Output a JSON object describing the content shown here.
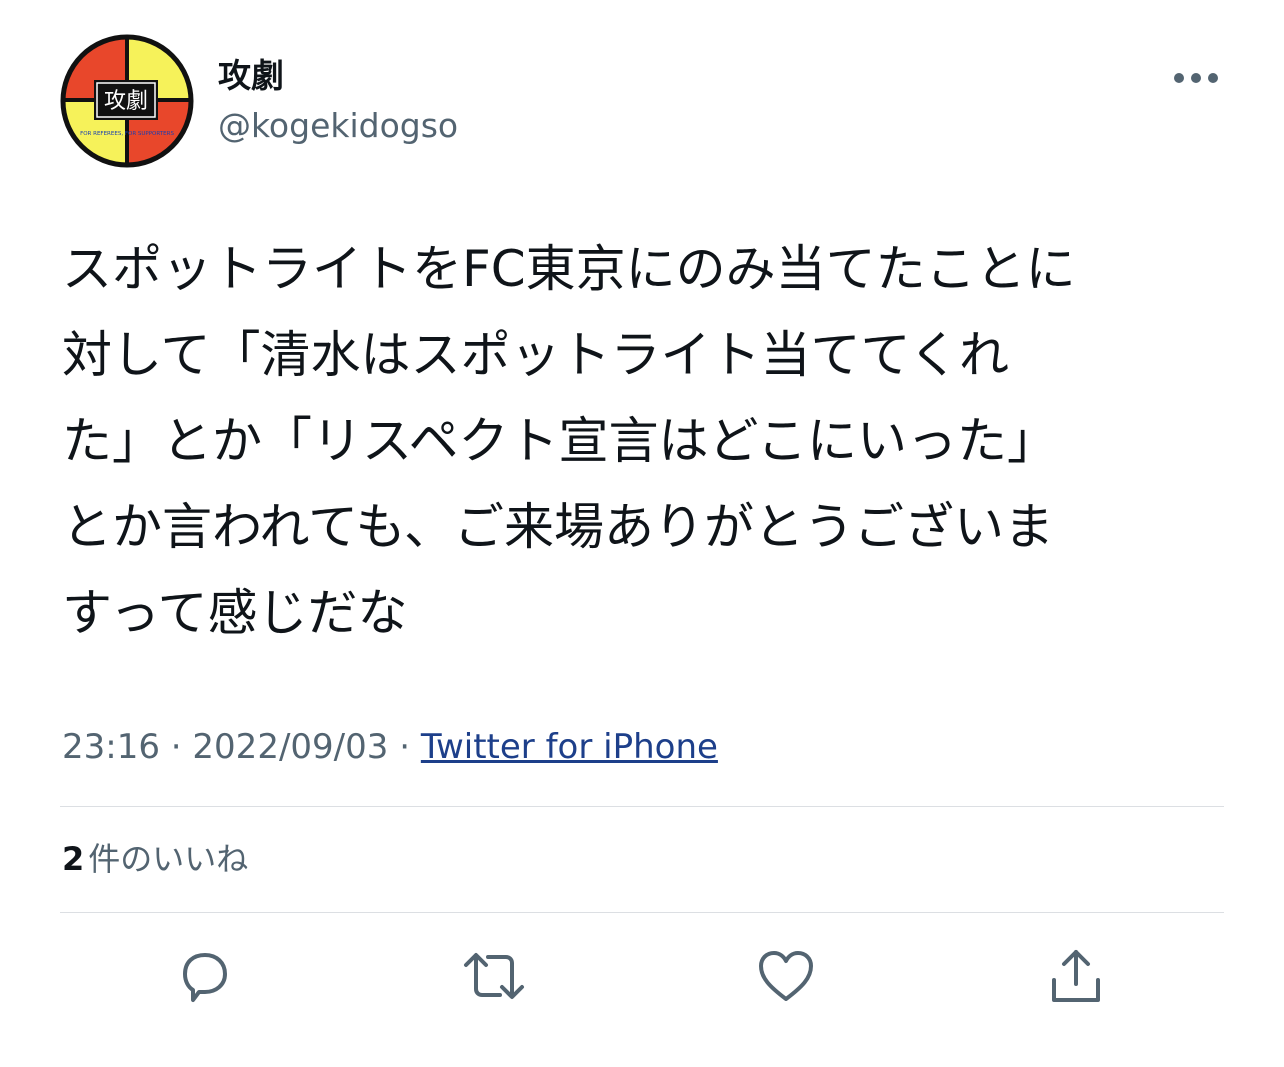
{
  "author": {
    "display_name": "攻劇",
    "handle": "@kogekidogso",
    "avatar_text": "攻劇",
    "avatar_tagline": "FOR REFEREES, FOR SUPPORTERS",
    "avatar_colors": {
      "red": "#e8472b",
      "yellow": "#f6f25a",
      "ring": "#111111"
    }
  },
  "tweet": {
    "text": "スポットライトをFC東京にのみ当てたことに\n対して「清水はスポットライト当ててくれ\nた」とか「リスペクト宣言はどこにいった」\nとか言われても、ご来場ありがとうございま\nすって感じだな",
    "time": "23:16",
    "date": "2022/09/03",
    "separator": "·",
    "source": "Twitter for iPhone"
  },
  "stats": {
    "likes_count": "2",
    "likes_label": "件のいいね"
  },
  "actions": [
    {
      "name": "reply",
      "icon": "reply-icon"
    },
    {
      "name": "retweet",
      "icon": "retweet-icon"
    },
    {
      "name": "like",
      "icon": "heart-icon"
    },
    {
      "name": "share",
      "icon": "share-icon"
    }
  ],
  "colors": {
    "text": "#0f1419",
    "secondary": "#536471",
    "link": "#1d3f8a",
    "divider": "#dcdfe3"
  }
}
